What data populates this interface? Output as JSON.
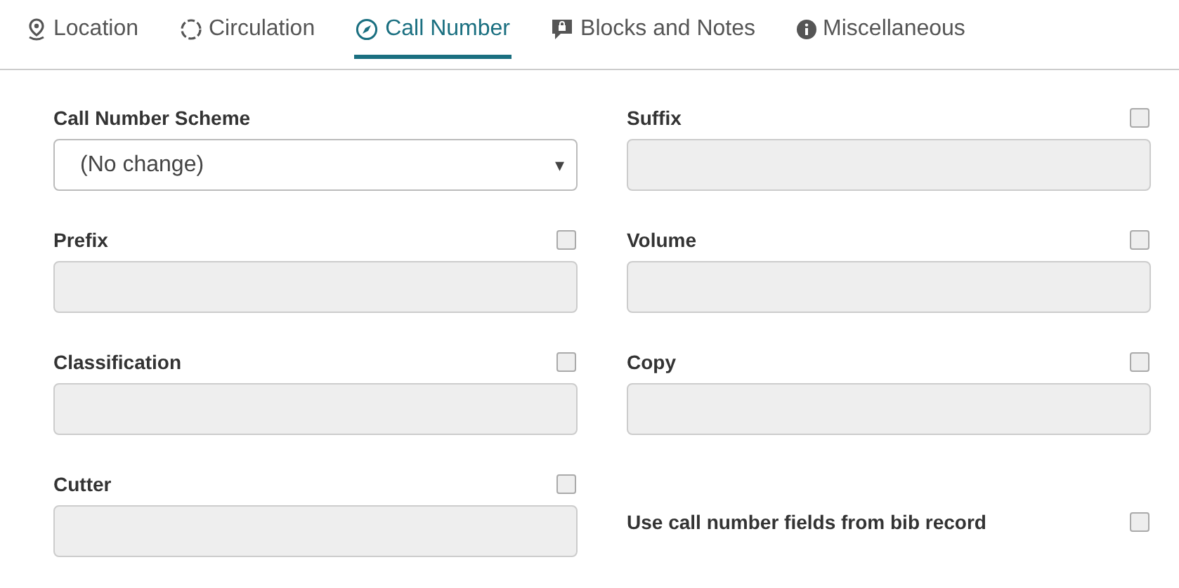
{
  "tabs": [
    {
      "label": "Location",
      "kind": "location",
      "selected": false
    },
    {
      "label": "Circulation",
      "kind": "circulation",
      "selected": false
    },
    {
      "label": "Call Number",
      "kind": "callnumber",
      "selected": true
    },
    {
      "label": "Blocks and Notes",
      "kind": "notes",
      "selected": false
    },
    {
      "label": "Miscellaneous",
      "kind": "misc",
      "selected": false
    }
  ],
  "left_fields": [
    {
      "kind": "select",
      "label": "Call Number Scheme",
      "value": "(No change)",
      "caret": "▾"
    },
    {
      "kind": "text",
      "label": "Prefix",
      "checked": false
    },
    {
      "kind": "text",
      "label": "Classification",
      "checked": false
    },
    {
      "kind": "text",
      "label": "Cutter",
      "checked": false
    }
  ],
  "right_fields": [
    {
      "kind": "text",
      "label": "Suffix",
      "checked": false
    },
    {
      "kind": "text",
      "label": "Volume",
      "checked": false
    },
    {
      "kind": "text",
      "label": "Copy",
      "checked": false
    },
    {
      "kind": "checkbox",
      "label": "Use call number fields from bib record",
      "checked": false
    }
  ]
}
